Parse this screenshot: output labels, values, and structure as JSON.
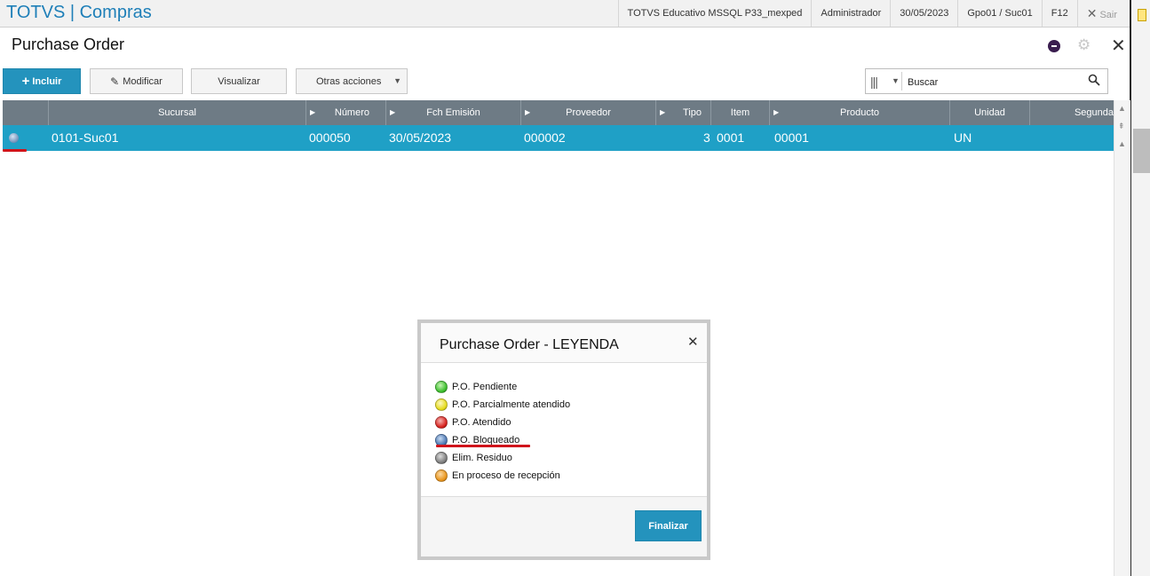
{
  "app": {
    "title": "TOTVS | Compras",
    "environment": "TOTVS Educativo MSSQL P33_mexped",
    "user": "Administrador",
    "date": "30/05/2023",
    "branch": "Gpo01 / Suc01",
    "help_key": "F12",
    "exit_label": "Sair"
  },
  "page": {
    "title": "Purchase Order"
  },
  "toolbar": {
    "incluir": "Incluir",
    "modificar": "Modificar",
    "visualizar": "Visualizar",
    "otras": "Otras acciones"
  },
  "search": {
    "placeholder": "Buscar"
  },
  "grid": {
    "columns": [
      "Sucursal",
      "Número",
      "Fch Emisión",
      "Proveedor",
      "Tipo",
      "Item",
      "Producto",
      "Unidad",
      "Segunda"
    ],
    "rows": [
      {
        "status": "P.O. Bloqueado",
        "sucursal": "0101-Suc01",
        "numero": "000050",
        "fecha": "30/05/2023",
        "proveedor": "000002",
        "tipo": "3",
        "item": "0001",
        "producto": "00001",
        "unidad": "UN"
      }
    ]
  },
  "legend_modal": {
    "title": "Purchase Order - LEYENDA",
    "items": [
      {
        "label": "P.O. Pendiente",
        "color": "#3cbf2e"
      },
      {
        "label": "P.O. Parcialmente atendido",
        "color": "#e6dc1c"
      },
      {
        "label": "P.O. Atendido",
        "color": "#d8231f"
      },
      {
        "label": "P.O. Bloqueado",
        "color": "#4f79b3"
      },
      {
        "label": "Elim. Residuo",
        "color": "#7d7d7d"
      },
      {
        "label": "En proceso de recepción",
        "color": "#e9951c"
      }
    ],
    "finalize_label": "Finalizar"
  },
  "colors": {
    "accent": "#2493bd",
    "selected_row": "#1fa0c6",
    "grid_header": "#6e7b85",
    "highlight_underline": "#d0141b"
  }
}
